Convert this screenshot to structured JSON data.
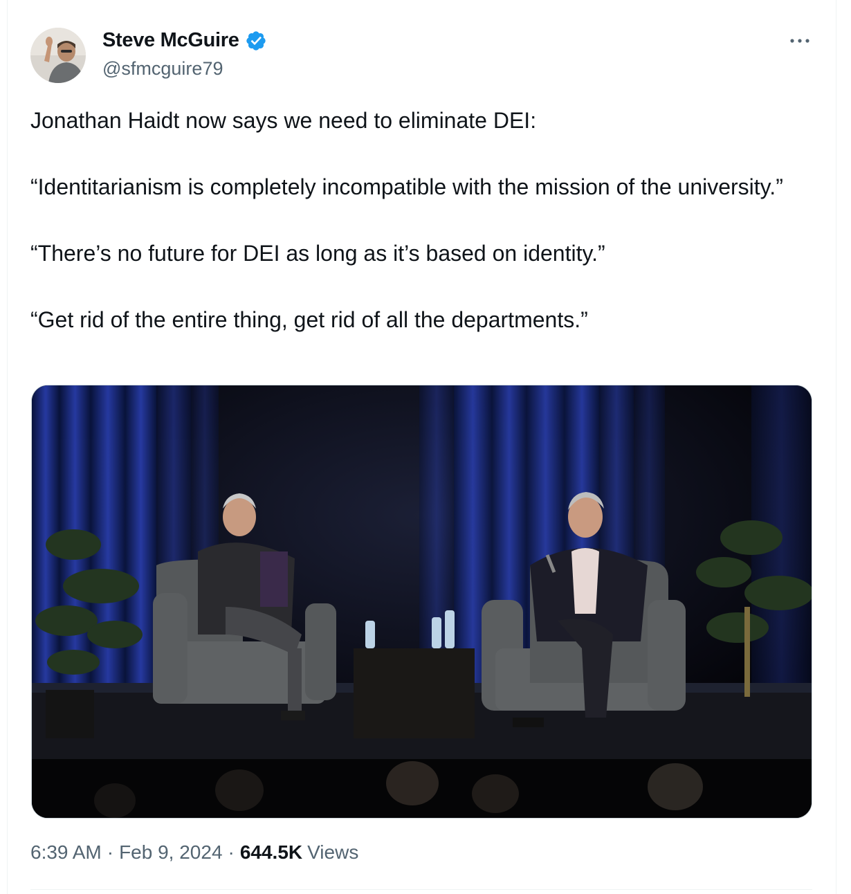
{
  "author": {
    "name": "Steve McGuire",
    "handle": "@sfmcguire79",
    "verified_color": "#1d9bf0"
  },
  "tweet": {
    "paragraphs": [
      "Jonathan Haidt now says we need to eliminate DEI:",
      "“Identitarianism is completely incompatible with the mission of the university.”",
      "“There’s no future for DEI as long as it’s based on identity.”",
      "“Get rid of the entire thing, get rid of all the departments.”"
    ]
  },
  "meta": {
    "time": "6:39 AM",
    "separator": "·",
    "date": "Feb 9, 2024",
    "views_count": "644.5K",
    "views_label": "Views"
  },
  "icons": {
    "verified": "verified-badge-icon",
    "more": "more-options-icon"
  },
  "colors": {
    "text": "#0f1419",
    "secondary": "#536471",
    "border": "#cfd9de"
  }
}
